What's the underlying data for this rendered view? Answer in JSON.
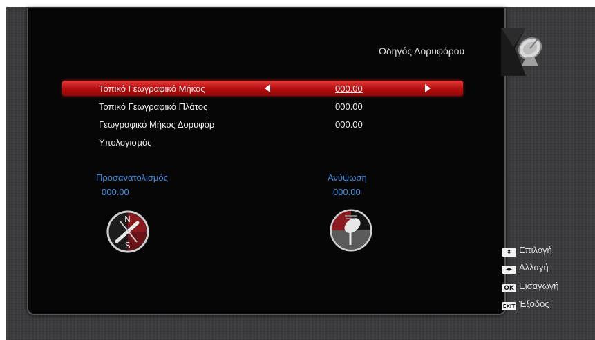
{
  "header": {
    "title": "Οδηγός Δορυφόρου",
    "icon": "satellite-dish-icon"
  },
  "menu": {
    "items": [
      {
        "label": "Τοπικό Γεωγραφικό Μήκος",
        "value": "000.00",
        "selected": true
      },
      {
        "label": "Τοπικό Γεωγραφικό Πλάτος",
        "value": "000.00"
      },
      {
        "label": "Γεωγραφικό Μήκος Δορυφόρ",
        "value": "000.00"
      },
      {
        "label": "Υπολογισμός",
        "value": ""
      }
    ]
  },
  "results": {
    "azimuth": {
      "label": "Προσανατολισμός",
      "value": "000.00",
      "compass_n": "N",
      "compass_s": "S"
    },
    "elevation": {
      "label": "Ανύψωση",
      "value": "000.00"
    }
  },
  "legend": [
    {
      "key": "⬍",
      "label": "Επιλογή",
      "icon": "up-down-key-icon"
    },
    {
      "key": "◂▸",
      "label": "Αλλαγή",
      "icon": "left-right-key-icon"
    },
    {
      "key": "OK",
      "label": "Εισαγωγή",
      "icon": "ok-key-icon"
    },
    {
      "key": "EXIT",
      "label": "Έξοδος",
      "icon": "exit-key-icon"
    }
  ],
  "colors": {
    "selection": "#c81414",
    "accent_blue": "#3e8fe0",
    "background": "#3a3a3c",
    "panel": "#060606"
  }
}
